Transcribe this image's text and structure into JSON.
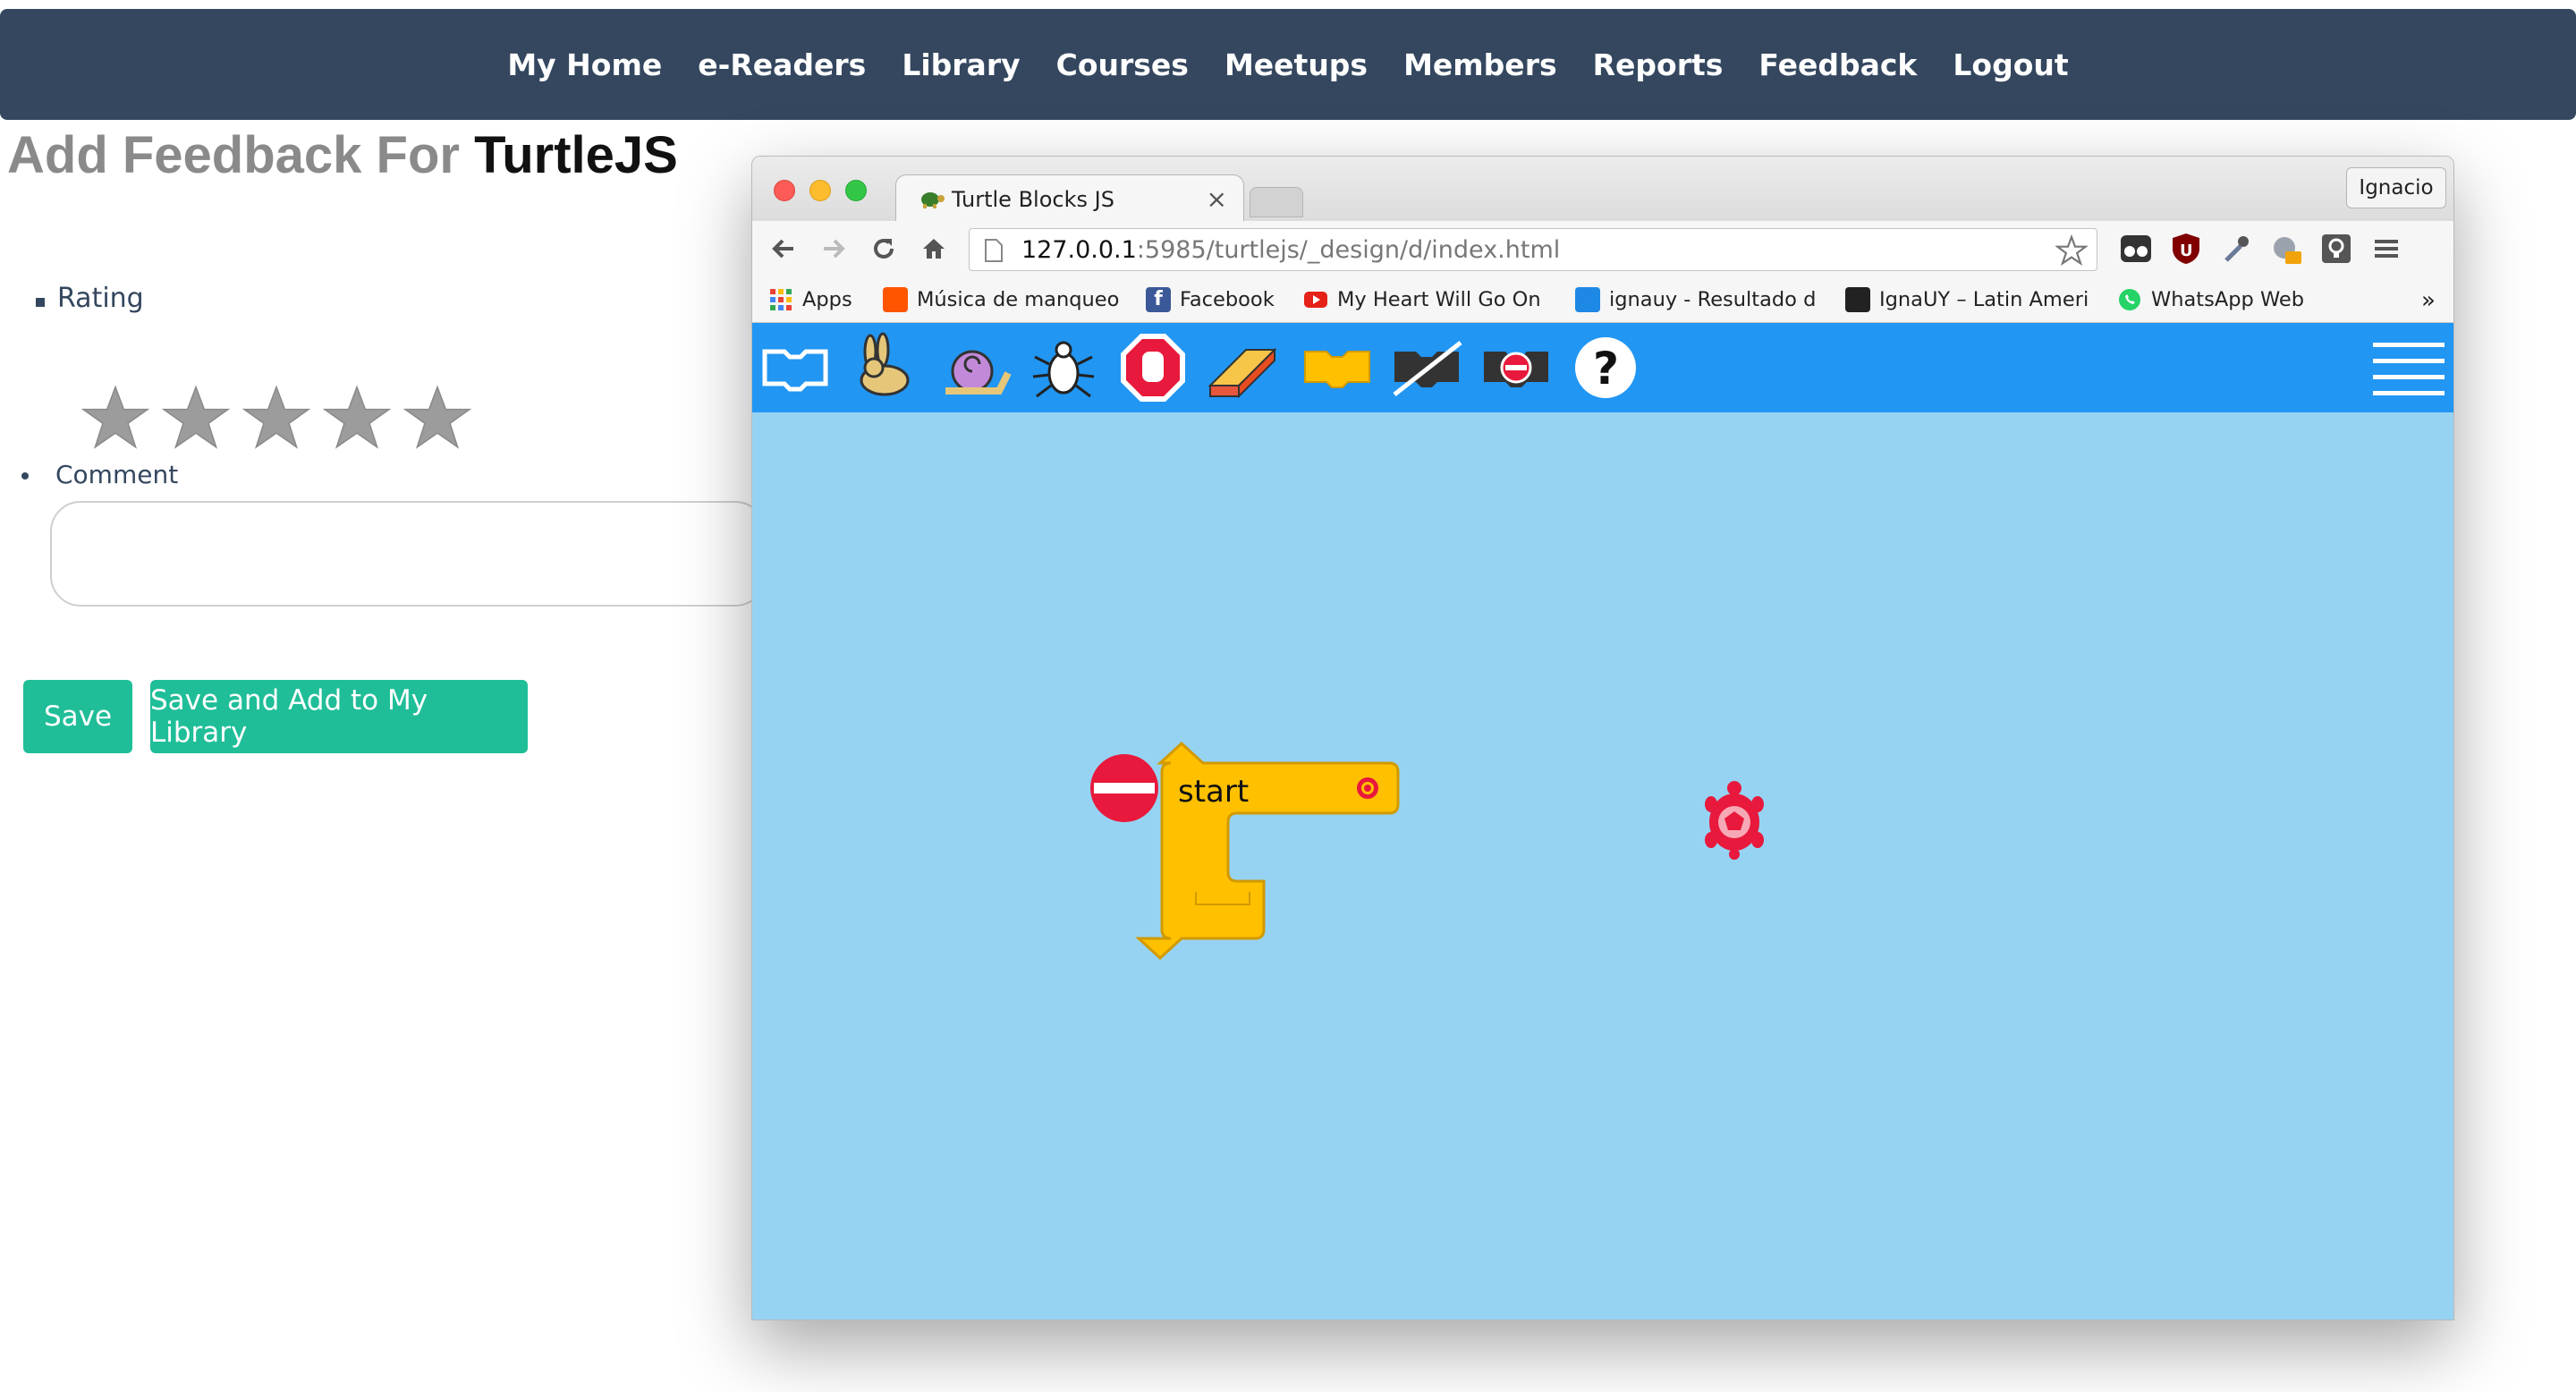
{
  "nav": {
    "items": [
      "My Home",
      "e-Readers",
      "Library",
      "Courses",
      "Meetups",
      "Members",
      "Reports",
      "Feedback",
      "Logout"
    ]
  },
  "page": {
    "title_prefix": "Add Feedback For",
    "title_app": "TurtleJS",
    "rating_label": "Rating",
    "rating_value": 0,
    "rating_max": 5,
    "comment_label": "Comment",
    "comment_value": "",
    "save_label": "Save",
    "save_add_label": "Save and Add to My Library"
  },
  "browser": {
    "tab_title": "Turtle Blocks JS",
    "tab_close": "×",
    "profile_name": "Ignacio",
    "url_host": "127.0.0.1",
    "url_rest": ":5985/turtlejs/_design/d/index.html",
    "bookmarks": [
      {
        "label": "Apps",
        "color": "#4285f4"
      },
      {
        "label": "Música de manqueo",
        "color": "#ff5500"
      },
      {
        "label": "Facebook",
        "color": "#3b5998"
      },
      {
        "label": "My Heart Will Go On",
        "color": "#e62117"
      },
      {
        "label": "ignauy - Resultado d",
        "color": "#1e88e5"
      },
      {
        "label": "IgnaUY – Latin Ameri",
        "color": "#222222"
      },
      {
        "label": "WhatsApp Web",
        "color": "#25d366"
      }
    ],
    "bookmarks_more": "»"
  },
  "turtle": {
    "bar_color": "#2196f3",
    "canvas_color": "#96d3f3",
    "palette_icons": [
      "run-icon",
      "rabbit-fast-icon",
      "snail-slow-icon",
      "bug-step-icon",
      "stop-hand-icon",
      "eraser-clear-icon",
      "block-collapse-icon",
      "hide-blocks-icon",
      "delete-block-icon",
      "help-icon"
    ],
    "start_block_label": "start",
    "block_color": "#ffc000",
    "turtle_color": "#e8193c"
  }
}
